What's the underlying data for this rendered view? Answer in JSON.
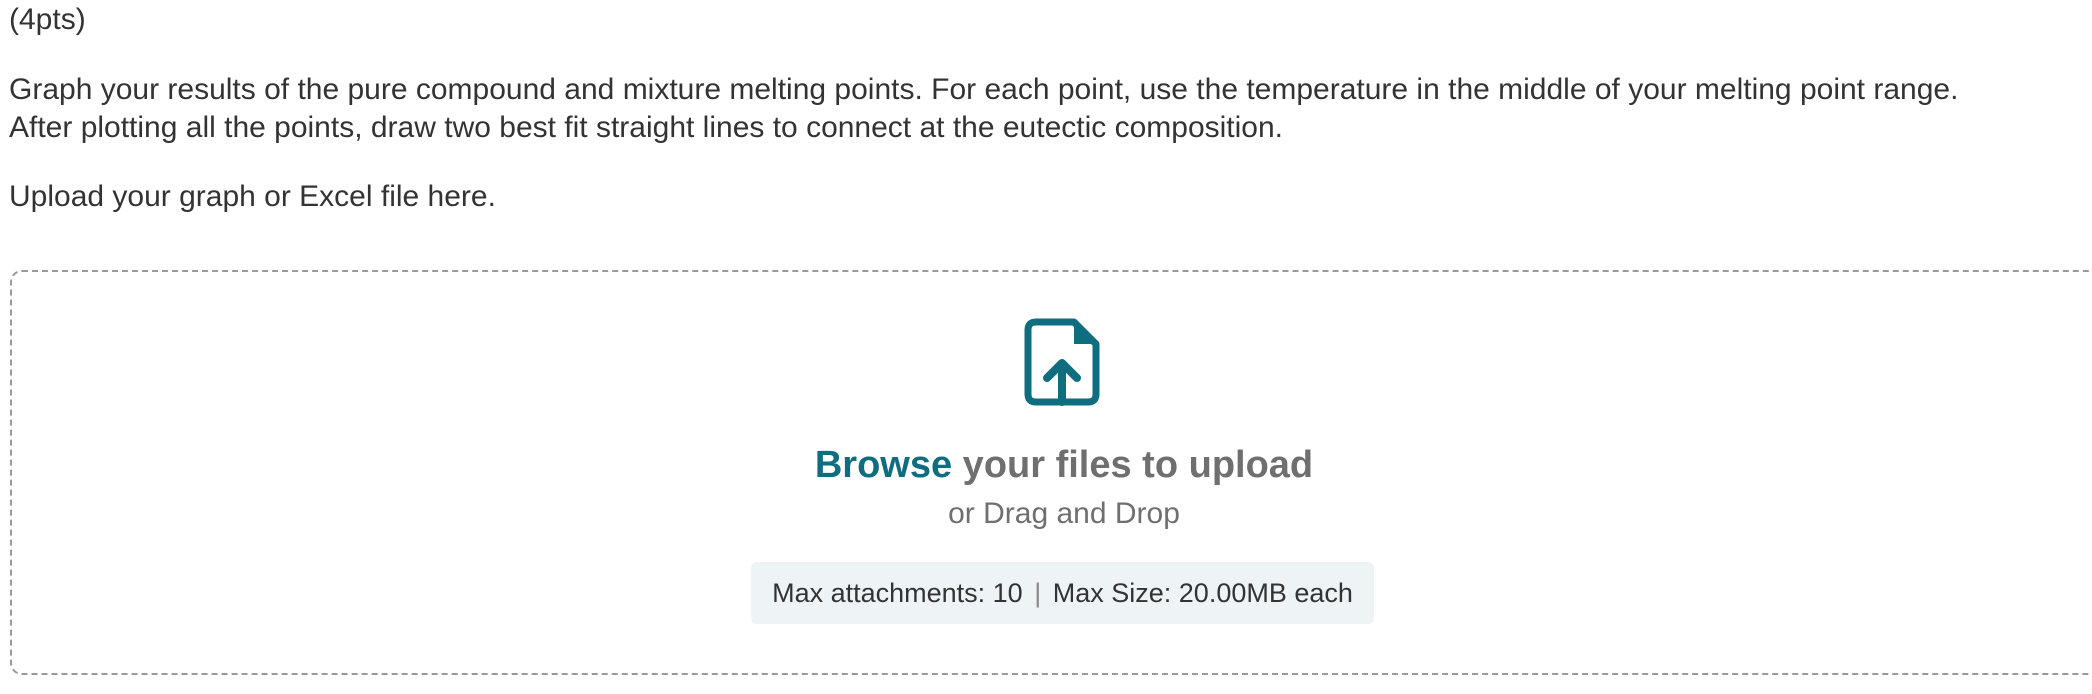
{
  "question": {
    "points": "(4pts)",
    "instruction_line1": "Graph your results of the pure compound and mixture melting points. For each point, use the temperature in the middle of your melting point range.",
    "instruction_line2": "After plotting all the points, draw two best fit straight lines to connect at the eutectic composition.",
    "upload_prompt": "Upload your graph or Excel file here."
  },
  "uploader": {
    "icon": "file-upload-icon",
    "browse_label": "Browse",
    "browse_suffix": " your files to upload",
    "drag_drop": "or Drag and Drop",
    "max_attachments": "Max attachments: 10",
    "separator": "|",
    "max_size": "Max Size: 20.00MB each",
    "accent_color": "#0e6e80",
    "muted_color": "#6f6f6f"
  }
}
